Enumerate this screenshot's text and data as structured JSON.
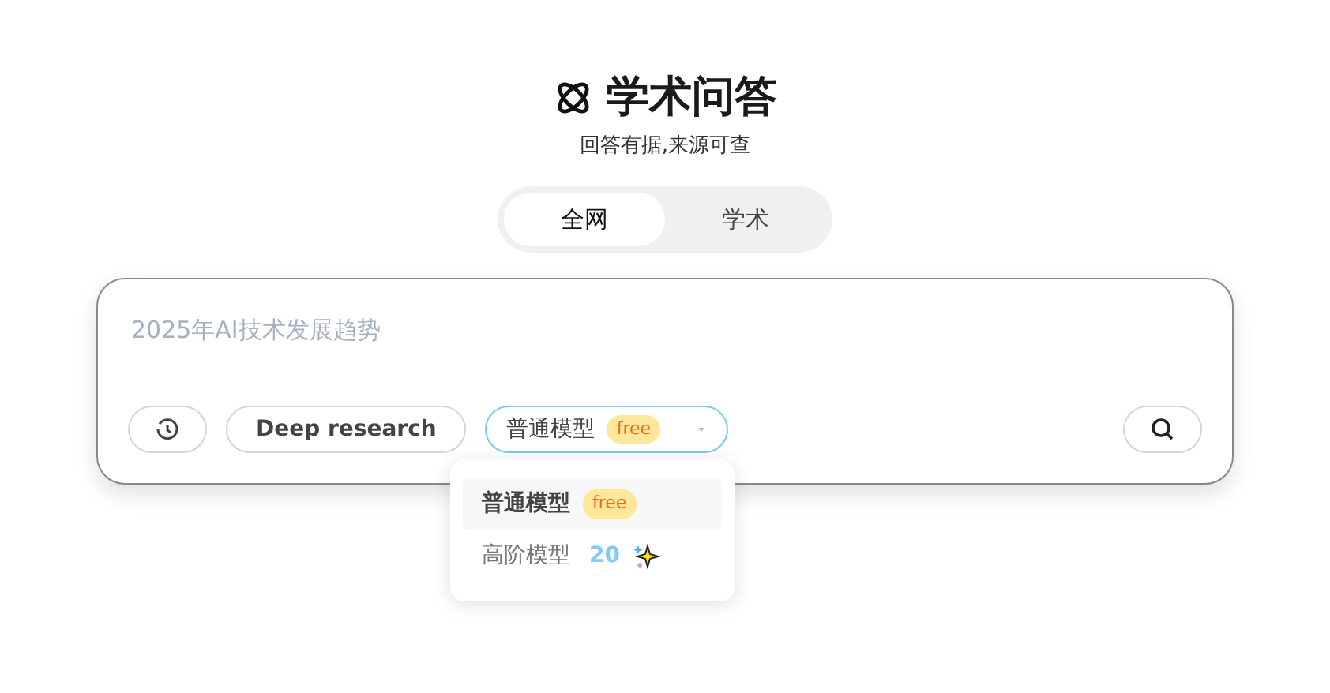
{
  "header": {
    "title": "学术问答",
    "subtitle": "回答有据,来源可查"
  },
  "tabs": [
    {
      "label": "全网",
      "selected": true
    },
    {
      "label": "学术",
      "selected": false
    }
  ],
  "search": {
    "placeholder": "2025年AI技术发展趋势"
  },
  "toolbar": {
    "deep_research": "Deep research",
    "model_select": {
      "label": "普通模型",
      "badge": "free",
      "open": true
    }
  },
  "model_menu": [
    {
      "label": "普通模型",
      "kind": "free",
      "badge": "free",
      "selected": true
    },
    {
      "label": "高阶模型",
      "kind": "cost",
      "cost": "20",
      "selected": false
    }
  ]
}
